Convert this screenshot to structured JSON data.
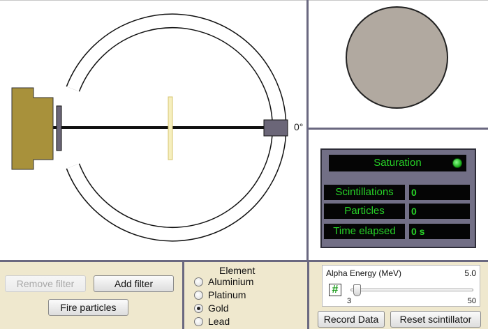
{
  "apparatus": {
    "angle_label": "0°",
    "source_color": "#a8913b",
    "foil_color": "#f6efbe",
    "detector_color": "#6b6678"
  },
  "scintillator": {
    "screen_color": "#b1a9a0"
  },
  "counter": {
    "saturation_label": "Saturation",
    "saturation_led": "on",
    "rows": [
      {
        "label": "Scintillations",
        "value": "0"
      },
      {
        "label": "Particles",
        "value": "0"
      },
      {
        "label": "Time elapsed",
        "value": "0 s"
      }
    ],
    "text_color": "#27d227"
  },
  "filter_controls": {
    "remove_filter": "Remove filter",
    "add_filter": "Add filter",
    "fire_particles": "Fire particles"
  },
  "element_panel": {
    "title": "Element",
    "options": [
      "Aluminium",
      "Platinum",
      "Gold",
      "Lead"
    ],
    "selected": "Gold"
  },
  "energy_panel": {
    "title": "Alpha Energy (MeV)",
    "value": "5.0",
    "min_label": "3",
    "max_label": "50",
    "hash_icon": "#",
    "slider_value_mev": 5.0
  },
  "actions": {
    "record_data": "Record Data",
    "reset_scintillator": "Reset scintillator"
  }
}
